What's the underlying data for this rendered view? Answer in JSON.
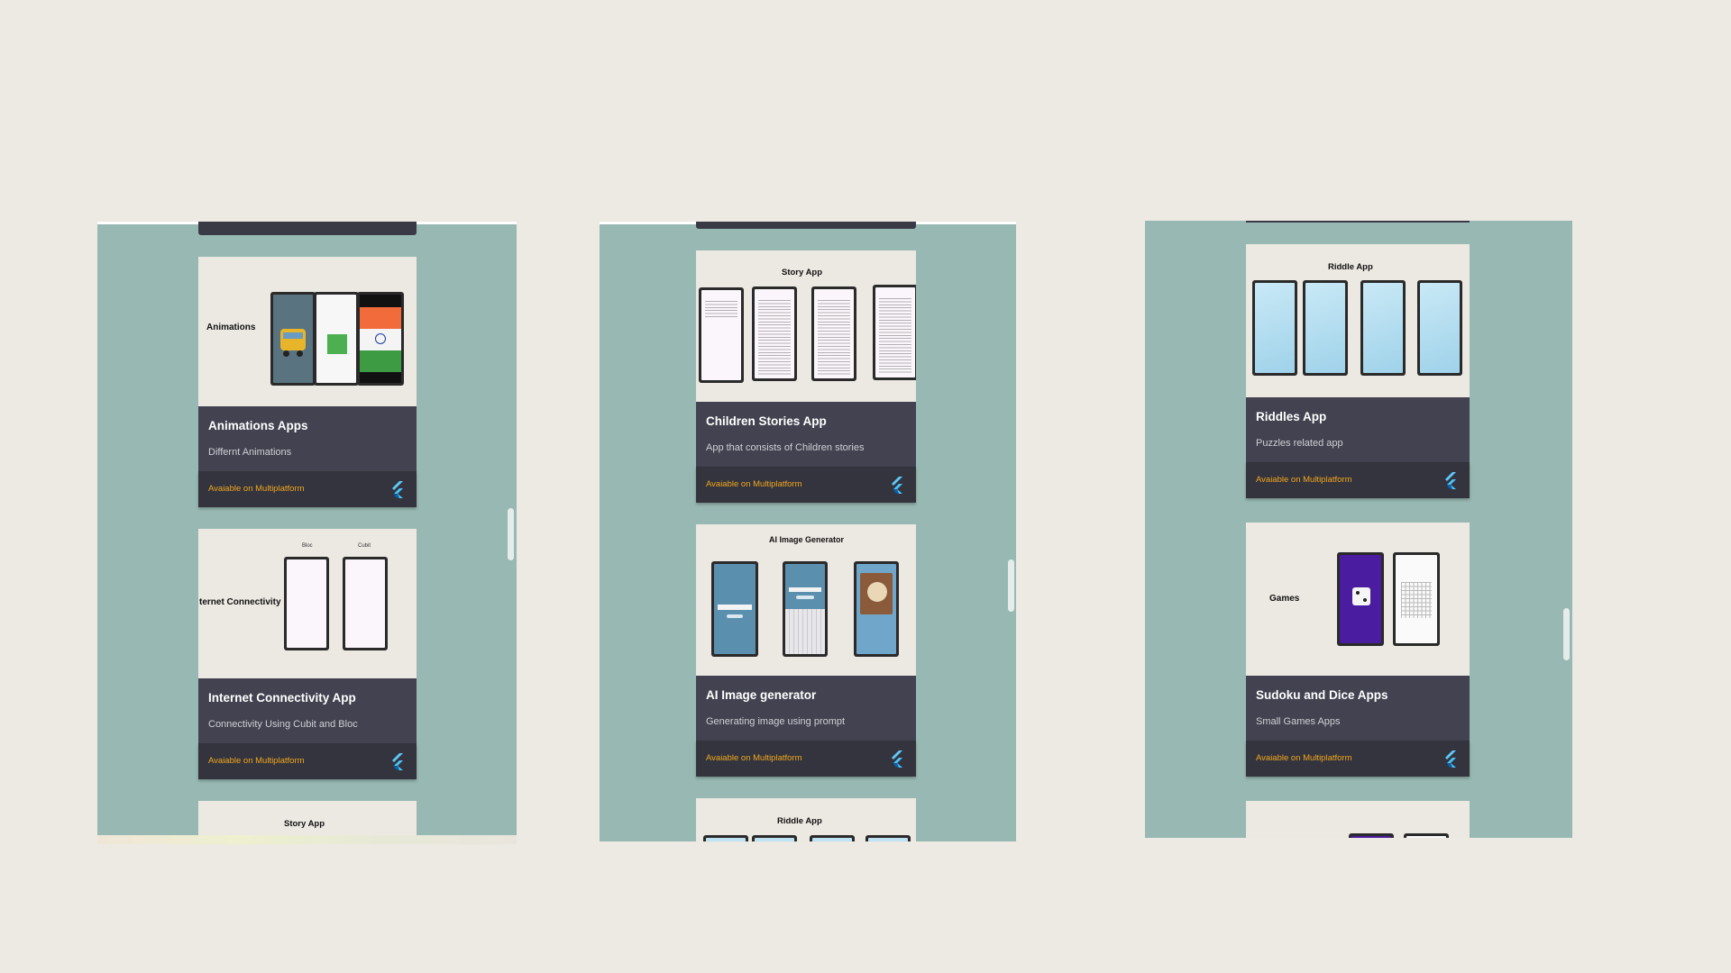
{
  "panels": [
    {
      "cards": [
        {
          "shot_label": "Animations",
          "title": "Animations Apps",
          "desc": "Differnt Animations",
          "avail": "Avaiable on Multiplatform"
        },
        {
          "shot_label": "ternet Connectivity",
          "mini_labels": [
            "Bloc",
            "Cubit"
          ],
          "title": "Internet Connectivity App",
          "desc": "Connectivity Using Cubit and Bloc",
          "avail": "Avaiable on Multiplatform"
        },
        {
          "shot_label": "Story App"
        }
      ]
    },
    {
      "cards": [
        {
          "shot_label": "Story App",
          "title": "Children Stories App",
          "desc": "App that consists of Children stories",
          "avail": "Avaiable on Multiplatform"
        },
        {
          "shot_label": "AI Image Generator",
          "title": "AI Image generator",
          "desc": "Generating image using prompt",
          "avail": "Avaiable on Multiplatform"
        },
        {
          "shot_label": "Riddle App"
        }
      ]
    },
    {
      "cards": [
        {
          "shot_label": "Riddle App",
          "title": "Riddles App",
          "desc": "Puzzles related app",
          "avail": "Avaiable on Multiplatform"
        },
        {
          "shot_label": "Games",
          "title": "Sudoku and Dice Apps",
          "desc": "Small Games Apps",
          "avail": "Avaiable on Multiplatform"
        },
        {}
      ]
    }
  ],
  "icons": {
    "platform": "flutter-icon"
  },
  "colors": {
    "panel_bg": "#98b9b3",
    "card_info": "#424250",
    "card_footer": "#34343f",
    "accent": "#f0a71b",
    "page_bg": "#ede9e3"
  }
}
